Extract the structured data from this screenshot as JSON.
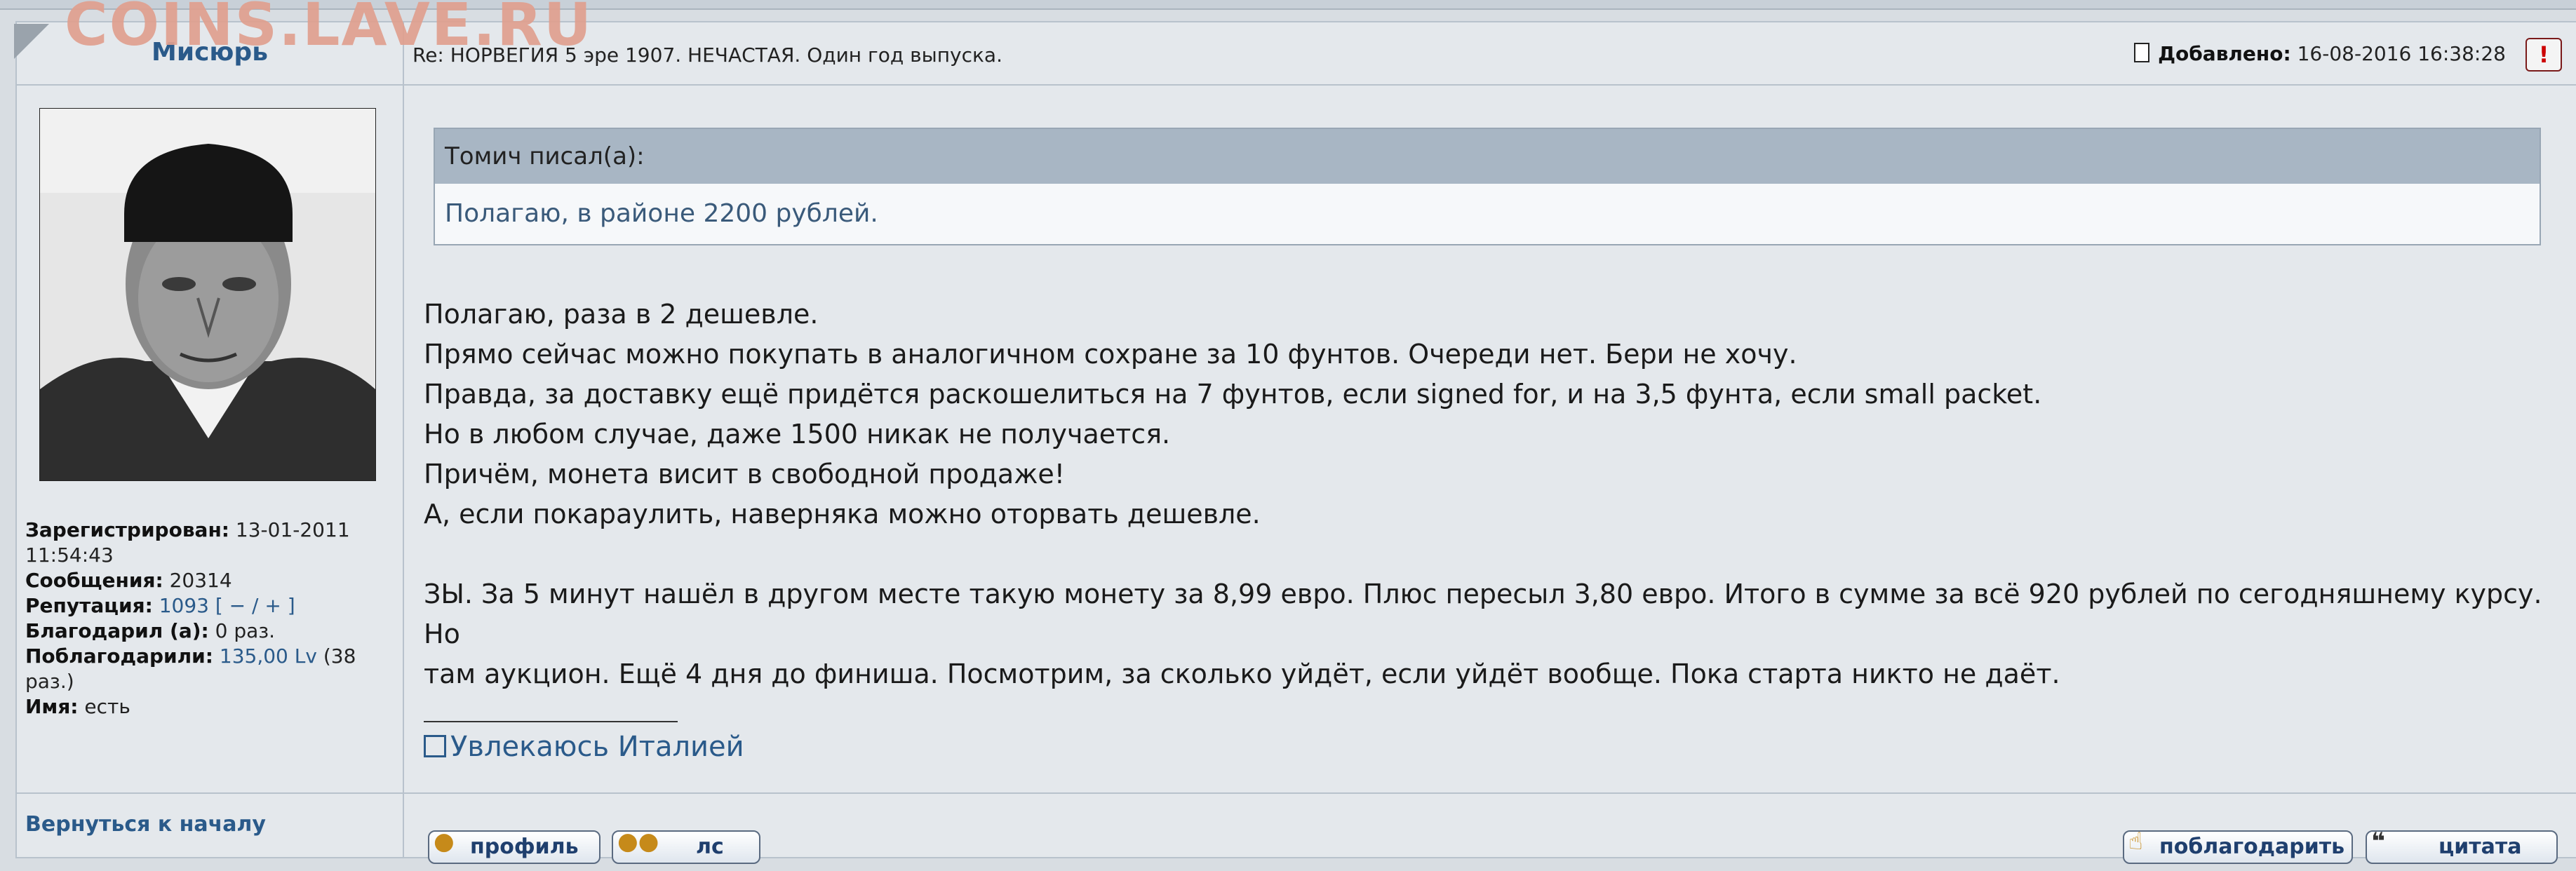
{
  "watermark": "COINS.LAVE.RU",
  "post": {
    "author": "Мисюрь",
    "subject": "Re: НОРВЕГИЯ 5 эре 1907. НЕЧАСТАЯ. Один год выпуска.",
    "added_label": "Добавлено:",
    "added_value": "16-08-2016 16:38:28",
    "report_symbol": "!",
    "quote": {
      "header": "Томич писал(а):",
      "text": "Полагаю, в районе 2200 рублей."
    },
    "message_lines": [
      "Полагаю, раза в 2 дешевле.",
      "Прямо сейчас можно покупать в аналогичном сохране за 10 фунтов. Очереди нет. Бери не хочу.",
      "Правда, за доставку ещё придётся раскошелиться на 7 фунтов, если signed for, и на 3,5 фунта, если small packet.",
      "Но в любом случае, даже 1500 никак не получается.",
      "Причём, монета висит в свободной продаже!",
      "А, если покараулить, наверняка можно оторвать дешевле.",
      "",
      "ЗЫ. За 5 минут нашёл в другом месте такую монету за 8,99 евро. Плюс пересыл 3,80 евро. Итого в сумме за всё 920 рублей по сегодняшнему курсу. Но",
      "там аукцион. Ещё 4 дня до финиша. Посмотрим, за сколько уйдёт, если уйдёт вообще. Пока старта никто не даёт."
    ],
    "signature": "Увлекаюсь Италией"
  },
  "profile": {
    "registered_label": "Зарегистрирован:",
    "registered_value": "13-01-2011 11:54:43",
    "messages_label": "Сообщения:",
    "messages_value": "20314",
    "reputation_label": "Репутация:",
    "reputation_value": "1093",
    "reputation_controls": "[ − / + ]",
    "thanked_label": "Благодарил (а):",
    "thanked_value": "0 раз.",
    "thanked_by_label": "Поблагодарили:",
    "thanked_by_value": "135,00 Lv",
    "thanked_by_count": "(38 раз.)",
    "name_label": "Имя:",
    "name_value": "есть"
  },
  "footer": {
    "back_to_top": "Вернуться к началу",
    "profile_button": "профиль",
    "pm_button": "лс",
    "thank_button": "поблагодарить",
    "quote_button": "цитата"
  }
}
